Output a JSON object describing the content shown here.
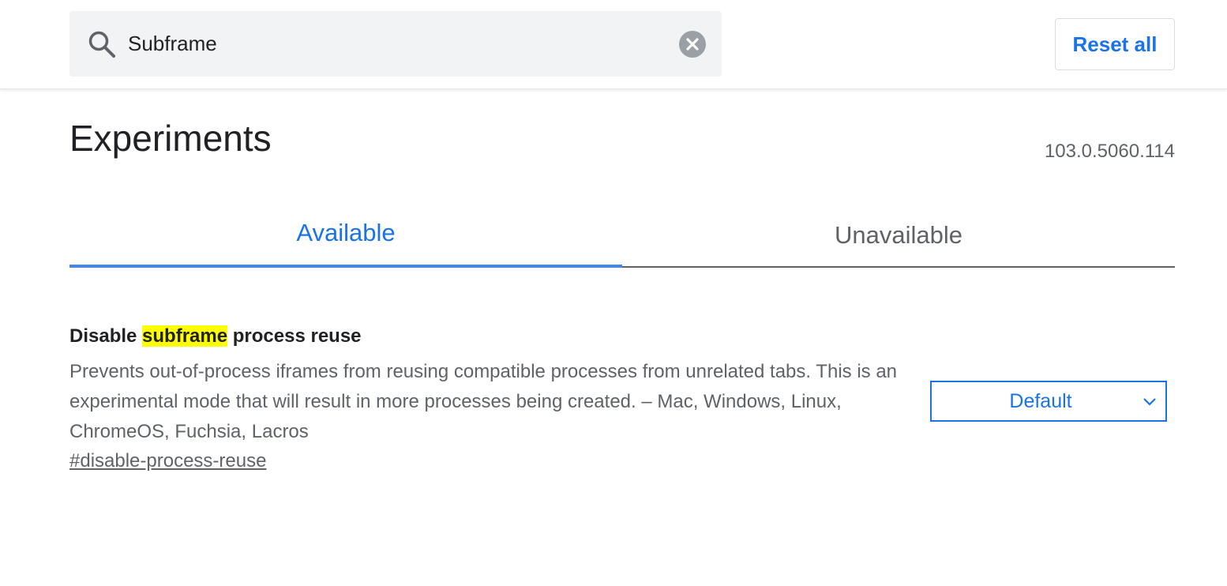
{
  "search": {
    "value": "Subframe",
    "placeholder": "Search flags"
  },
  "header": {
    "reset_label": "Reset all"
  },
  "page": {
    "title": "Experiments",
    "version": "103.0.5060.114"
  },
  "tabs": [
    {
      "label": "Available",
      "selected": true
    },
    {
      "label": "Unavailable",
      "selected": false
    }
  ],
  "experiment": {
    "title_before": "Disable ",
    "title_highlight": "subframe",
    "title_after": " process reuse",
    "description": "Prevents out-of-process iframes from reusing compatible processes from unrelated tabs. This is an experimental mode that will result in more processes being created. – Mac, Windows, Linux, ChromeOS, Fuchsia, Lacros",
    "link": "#disable-process-reuse",
    "select_value": "Default"
  },
  "colors": {
    "accent": "#1a73e8",
    "highlight": "#ffff00",
    "search_bg": "#f1f3f4"
  },
  "icons": {
    "search": "search-icon",
    "clear": "clear-icon",
    "dropdown": "chevron-down-icon"
  }
}
